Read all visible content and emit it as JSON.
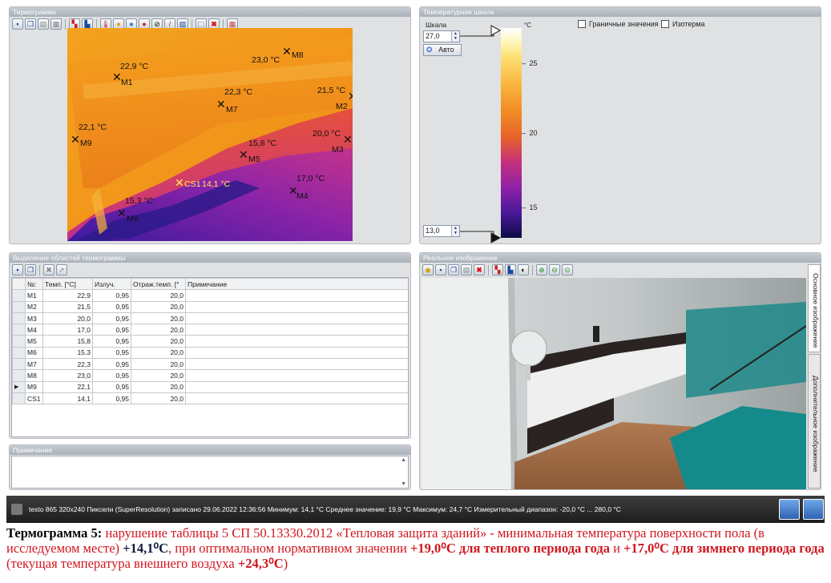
{
  "panels": {
    "thermogram": "Термограмма",
    "scale": "Температурная шкала",
    "regions": "Выделение областей термограммы",
    "note": "Примечание",
    "real": "Реальное изображение"
  },
  "markers": [
    {
      "id": "M1",
      "temp": "22,9 °C"
    },
    {
      "id": "M2",
      "temp": "21,5 °C"
    },
    {
      "id": "M3",
      "temp": "20,0 °C"
    },
    {
      "id": "M4",
      "temp": "17,0 °C"
    },
    {
      "id": "M5",
      "temp": "15,8 °C"
    },
    {
      "id": "M6",
      "temp": "15,3 °C"
    },
    {
      "id": "M7",
      "temp": "22,3 °C"
    },
    {
      "id": "M8",
      "temp": "23,0 °C"
    },
    {
      "id": "M9",
      "temp": "22,1 °C"
    },
    {
      "id": "CS1",
      "temp": "14,1 °C"
    }
  ],
  "scale": {
    "label": "Шкала",
    "max": "27,0",
    "min": "13,0",
    "auto": "Авто",
    "unit": "°C",
    "ticks": [
      "25",
      "20",
      "15"
    ],
    "limits": "Граничные значения",
    "isotherm": "Изотерма"
  },
  "table": {
    "headers": [
      "№:",
      "Темп. [°C]",
      "Излуч.",
      "Отраж.темп. [°",
      "Примечание"
    ],
    "rows": [
      [
        "M1",
        "22,9",
        "0,95",
        "20,0",
        ""
      ],
      [
        "M2",
        "21,5",
        "0,95",
        "20,0",
        ""
      ],
      [
        "M3",
        "20,0",
        "0,95",
        "20,0",
        ""
      ],
      [
        "M4",
        "17,0",
        "0,95",
        "20,0",
        ""
      ],
      [
        "M5",
        "15,8",
        "0,95",
        "20,0",
        ""
      ],
      [
        "M6",
        "15,3",
        "0,95",
        "20,0",
        ""
      ],
      [
        "M7",
        "22,3",
        "0,95",
        "20,0",
        ""
      ],
      [
        "M8",
        "23,0",
        "0,95",
        "20,0",
        ""
      ],
      [
        "M9",
        "22,1",
        "0,95",
        "20,0",
        ""
      ],
      [
        "CS1",
        "14,1",
        "0,95",
        "20,0",
        ""
      ]
    ]
  },
  "tabs": {
    "main": "Основное изображение",
    "extra": "Дополнительное изображение"
  },
  "status": "testo 865 320x240 Пиксели (SuperResolution) записано 29.06.2022 12:36:56 Минимум: 14,1 °C Среднее значение: 19,9 °C Максимум: 24,7 °C Измерительный диапазон: -20,0 °C ... 280,0 °C",
  "caption": {
    "label": "Термограмма 5:",
    "t1": " нарушение таблицы 5 СП 50.13330.2012 «Тепловая защита зданий» - минимальная температура поверхности пола (в исследуемом месте) ",
    "v1": "+14,1⁰С",
    "t2": ", при оптимальном нормативном значении ",
    "v2": "+19,0⁰С для теплого периода года",
    "t3": " и ",
    "v3": "+17,0⁰С для зимнего периода года",
    "t4": " (текущая температура внешнего воздуха ",
    "v4": "+24,3⁰С",
    "t5": ")"
  }
}
